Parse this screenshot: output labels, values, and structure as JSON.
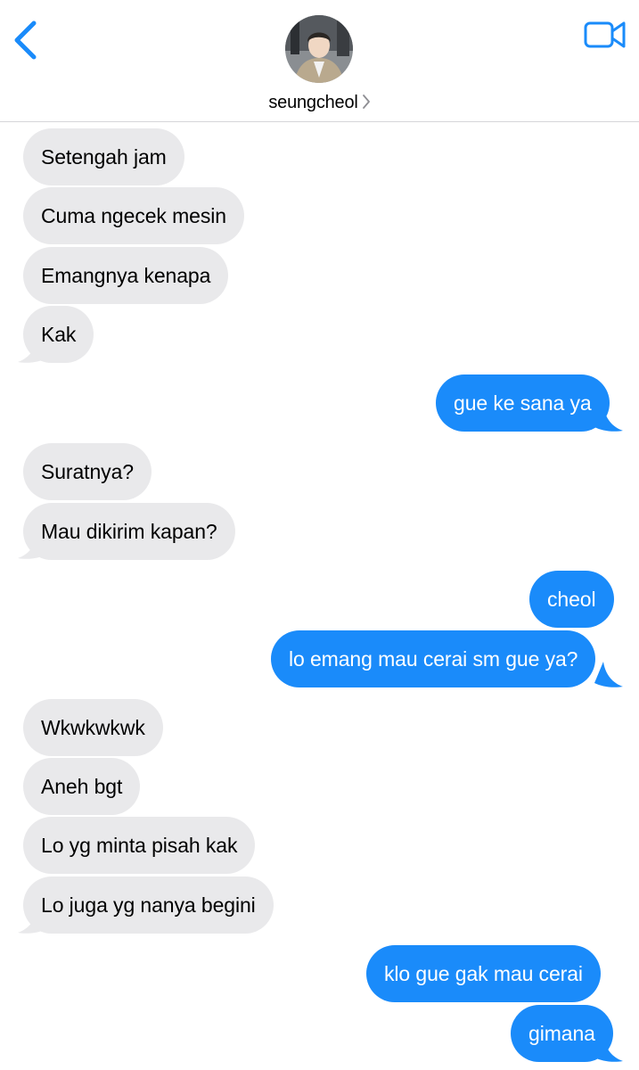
{
  "header": {
    "contact_name": "seungcheol",
    "back_icon": "chevron-left-icon",
    "video_icon": "video-camera-icon",
    "accent_color": "#1a8bfa"
  },
  "messages": [
    {
      "from": "them",
      "text": "Setengah jam"
    },
    {
      "from": "them",
      "text": "Cuma ngecek mesin"
    },
    {
      "from": "them",
      "text": "Emangnya kenapa"
    },
    {
      "from": "them",
      "text": "Kak"
    },
    {
      "from": "me",
      "text": "gue ke sana ya"
    },
    {
      "from": "them",
      "text": "Suratnya?"
    },
    {
      "from": "them",
      "text": "Mau dikirim kapan?"
    },
    {
      "from": "me",
      "text": "cheol"
    },
    {
      "from": "me",
      "text": "lo emang mau cerai sm gue ya?"
    },
    {
      "from": "them",
      "text": "Wkwkwkwk"
    },
    {
      "from": "them",
      "text": "Aneh bgt"
    },
    {
      "from": "them",
      "text": "Lo yg minta pisah kak"
    },
    {
      "from": "them",
      "text": "Lo juga yg nanya begini"
    },
    {
      "from": "me",
      "text": "klo gue gak mau cerai"
    },
    {
      "from": "me",
      "text": "gimana"
    }
  ],
  "colors": {
    "received_bubble": "#e9e9eb",
    "sent_bubble": "#1a8bfa"
  }
}
